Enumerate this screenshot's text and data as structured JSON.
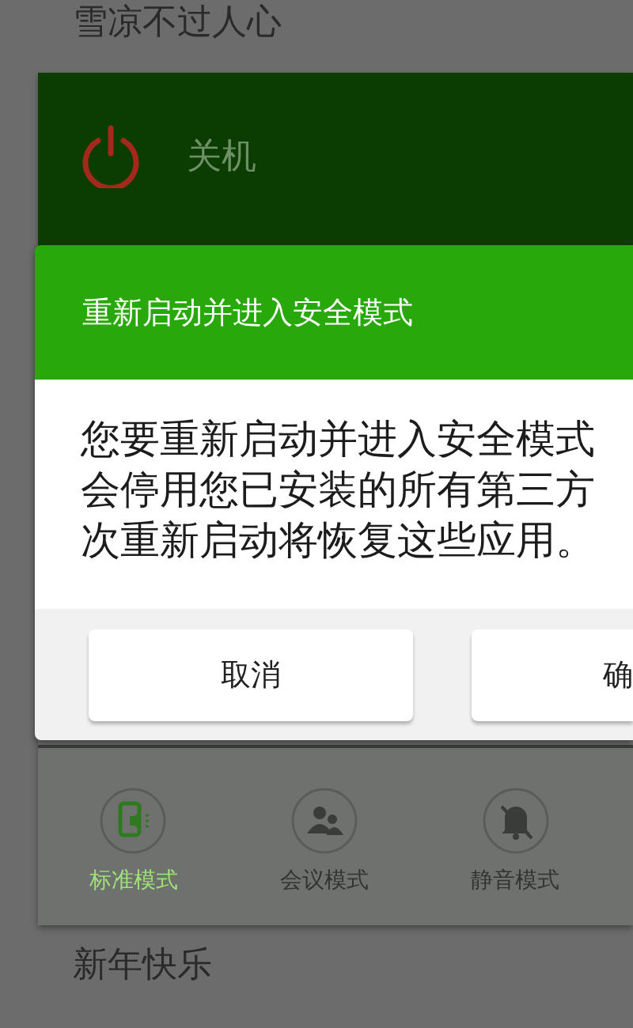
{
  "background_list": [
    {
      "title": "雪凉不过人心"
    },
    {
      "title": "新年快乐"
    }
  ],
  "power_menu": {
    "items": [
      {
        "label": "关机",
        "kind": "power"
      }
    ],
    "modes": [
      {
        "label": "标准模式",
        "kind": "standard",
        "selected": true
      },
      {
        "label": "会议模式",
        "kind": "meeting",
        "selected": false
      },
      {
        "label": "静音模式",
        "kind": "silent",
        "selected": false
      }
    ]
  },
  "dialog": {
    "title": "重新启动并进入安全模式",
    "message_lines": [
      "您要重新启动并进入安全模式",
      "会停用您已安装的所有第三方",
      "次重新启动将恢复这些应用。"
    ],
    "buttons": [
      {
        "label": "取消",
        "kind": "cancel"
      },
      {
        "label": "确",
        "kind": "confirm"
      }
    ]
  }
}
